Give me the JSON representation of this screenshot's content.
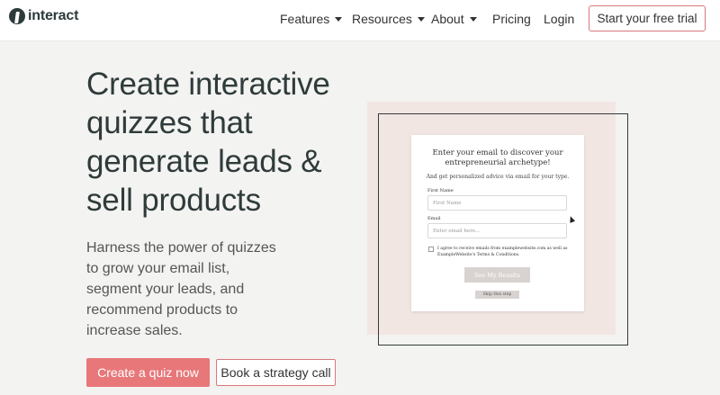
{
  "header": {
    "logo_text": "interact",
    "nav": [
      {
        "label": "Features",
        "has_dropdown": true
      },
      {
        "label": "Resources",
        "has_dropdown": true
      },
      {
        "label": "About",
        "has_dropdown": true
      },
      {
        "label": "Pricing",
        "has_dropdown": false
      },
      {
        "label": "Login",
        "has_dropdown": false
      }
    ],
    "cta_label": "Start your free trial"
  },
  "hero": {
    "title": "Create interactive quizzes that generate leads & sell products",
    "subtitle": "Harness the power of quizzes to grow your email list, segment your leads, and recommend products to increase sales.",
    "primary_button": "Create a quiz now",
    "secondary_button": "Book a strategy call"
  },
  "quiz_card": {
    "title": "Enter your email to discover your entrepreneurial archetype!",
    "subtitle": "And get personalized advice via email for your type.",
    "first_name_label": "First Name",
    "first_name_placeholder": "First Name",
    "email_label": "Email",
    "email_placeholder": "Enter email here...",
    "consent_text": "I agree to receive emails from examplewebsite.com as well as ExampleWebsite's Terms & Conditions.",
    "consent_checked": false,
    "results_button": "See My Results",
    "skip_button": "Skip this step"
  },
  "colors": {
    "accent": "#e8777a",
    "accent_border": "#d9777a",
    "text_dark": "#2f3b3b",
    "page_bg": "#f3f3f1",
    "illustration_bg": "#f2e6e3"
  }
}
